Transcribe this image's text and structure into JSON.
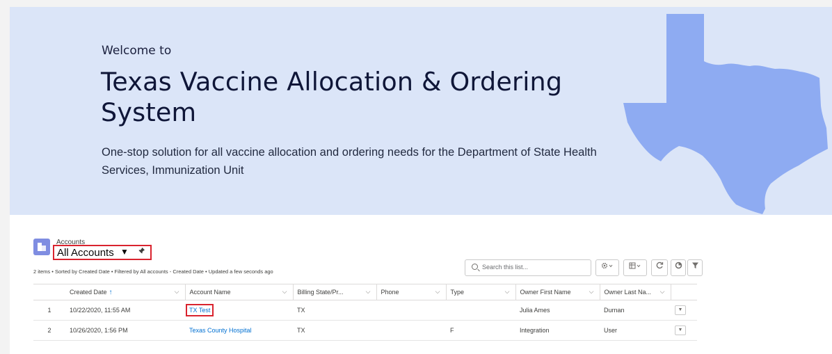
{
  "hero": {
    "welcome": "Welcome to",
    "title": "Texas Vaccine Allocation & Ordering System",
    "subtitle": "One-stop solution for all vaccine allocation and ordering needs for the Department of State Health Services, Immunization Unit",
    "map_color": "#8eabf2",
    "background": "#dbe5f8"
  },
  "list_view": {
    "object_label": "Accounts",
    "view_name": "All Accounts",
    "caret": "▼",
    "pin_icon": "pin-icon",
    "info": "2 items • Sorted by Created Date • Filtered by All accounts - Created Date • Updated a few seconds ago",
    "search_placeholder": "Search this list...",
    "toolbar_icons": [
      "gear-icon",
      "table-view-icon",
      "refresh-icon",
      "chart-icon",
      "filter-icon"
    ]
  },
  "table": {
    "columns": [
      {
        "label": "Created Date",
        "sorted": "↑"
      },
      {
        "label": "Account Name"
      },
      {
        "label": "Billing State/Pr..."
      },
      {
        "label": "Phone"
      },
      {
        "label": "Type"
      },
      {
        "label": "Owner First Name"
      },
      {
        "label": "Owner Last Na..."
      }
    ],
    "rows": [
      {
        "num": "1",
        "created": "10/22/2020, 11:55 AM",
        "account": "TX Test",
        "state": "TX",
        "phone": "",
        "type": "",
        "first": "Julia Ames",
        "last": "Durnan"
      },
      {
        "num": "2",
        "created": "10/26/2020, 1:56 PM",
        "account": "Texas County Hospital",
        "state": "TX",
        "phone": "",
        "type": "F",
        "first": "Integration",
        "last": "User"
      }
    ],
    "link_color": "#0070d2",
    "highlight_color": "#d9232e"
  }
}
